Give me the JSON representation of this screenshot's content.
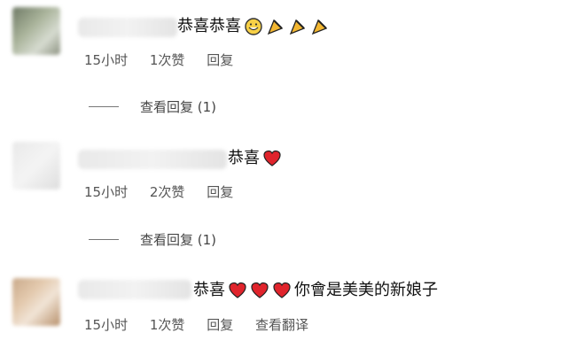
{
  "comments": [
    {
      "text": "恭喜恭喜",
      "emojis": [
        "grinning-face-emoji",
        "party-popper-icon",
        "party-popper-icon",
        "party-popper-icon"
      ],
      "time": "15小时",
      "likes": "1次赞",
      "reply": "回复",
      "more_replies": "查看回复 (1)"
    },
    {
      "text": "恭喜",
      "emojis": [
        "red-heart-icon"
      ],
      "time": "15小时",
      "likes": "2次赞",
      "reply": "回复",
      "more_replies": "查看回复 (1)"
    },
    {
      "text_before": "恭喜",
      "emojis": [
        "red-heart-icon",
        "red-heart-icon",
        "red-heart-icon"
      ],
      "text_after": "你會是美美的新娘子",
      "time": "15小时",
      "likes": "1次赞",
      "reply": "回复",
      "translate": "查看翻译"
    }
  ],
  "colors": {
    "heart": "#e0242c",
    "party": "#f3b731",
    "text": "#111111",
    "meta": "#555555"
  }
}
